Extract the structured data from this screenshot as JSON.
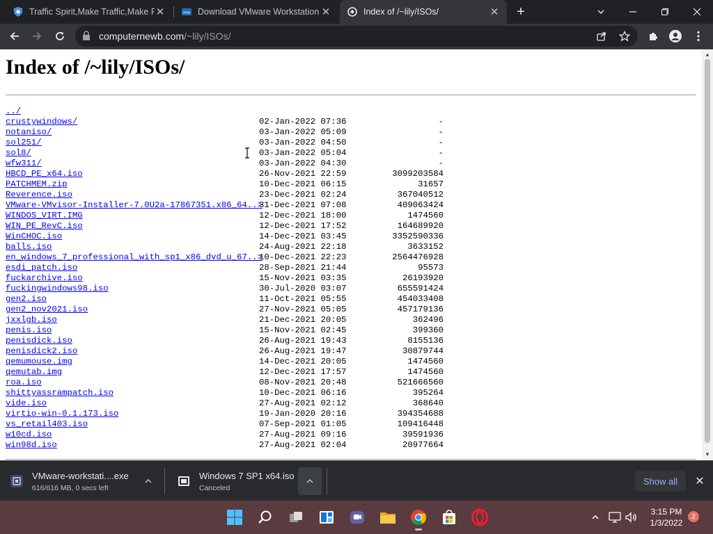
{
  "tabs": [
    {
      "title": "Traffic Spirit,Make Traffic,Make Free",
      "active": false
    },
    {
      "title": "Download VMware Workstation Pro",
      "active": false
    },
    {
      "title": "Index of /~lily/ISOs/",
      "active": true
    }
  ],
  "address": {
    "host": "computernewb.com",
    "path": "/~lily/ISOs/"
  },
  "page": {
    "heading": "Index of /~lily/ISOs/",
    "parent_link": "../",
    "rows": [
      {
        "name": "crustywindows/",
        "date": "02-Jan-2022 07:36",
        "size": "-"
      },
      {
        "name": "notaniso/",
        "date": "03-Jan-2022 05:09",
        "size": "-"
      },
      {
        "name": "sol251/",
        "date": "03-Jan-2022 04:50",
        "size": "-"
      },
      {
        "name": "sol8/",
        "date": "03-Jan-2022 05:04",
        "size": "-"
      },
      {
        "name": "wfw311/",
        "date": "03-Jan-2022 04:30",
        "size": "-"
      },
      {
        "name": "HBCD_PE_x64.iso",
        "date": "26-Nov-2021 22:59",
        "size": "3099203584"
      },
      {
        "name": "PATCHMEM.zip",
        "date": "10-Dec-2021 06:15",
        "size": "31657"
      },
      {
        "name": "Reverence.iso",
        "date": "23-Dec-2021 02:24",
        "size": "367040512"
      },
      {
        "name": "VMware-VMvisor-Installer-7.0U2a-17867351.x86_64..>",
        "date": "31-Dec-2021 07:08",
        "size": "409063424"
      },
      {
        "name": "WINDOS_VIRT.IMG",
        "date": "12-Dec-2021 18:00",
        "size": "1474560"
      },
      {
        "name": "WIN_PE_RevC.iso",
        "date": "12-Dec-2021 17:52",
        "size": "164689920"
      },
      {
        "name": "WinCHOC.iso",
        "date": "14-Dec-2021 03:45",
        "size": "3352590336"
      },
      {
        "name": "balls.iso",
        "date": "24-Aug-2021 22:18",
        "size": "3633152"
      },
      {
        "name": "en_windows_7_professional_with_sp1_x86_dvd_u_67..>",
        "date": "10-Dec-2021 22:23",
        "size": "2564476928"
      },
      {
        "name": "esdi_patch.iso",
        "date": "28-Sep-2021 21:44",
        "size": "95573"
      },
      {
        "name": "fuckarchive.iso",
        "date": "15-Nov-2021 03:35",
        "size": "26193920"
      },
      {
        "name": "fuckingwindows98.iso",
        "date": "30-Jul-2020 03:07",
        "size": "655591424"
      },
      {
        "name": "gen2.iso",
        "date": "11-Oct-2021 05:55",
        "size": "454033408"
      },
      {
        "name": "gen2_nov2021.iso",
        "date": "27-Nov-2021 05:05",
        "size": "457179136"
      },
      {
        "name": "jxxlgb.iso",
        "date": "21-Dec-2021 20:05",
        "size": "362496"
      },
      {
        "name": "penis.iso",
        "date": "15-Nov-2021 02:45",
        "size": "399360"
      },
      {
        "name": "penisdick.iso",
        "date": "26-Aug-2021 19:43",
        "size": "8155136"
      },
      {
        "name": "penisdick2.iso",
        "date": "26-Aug-2021 19:47",
        "size": "30879744"
      },
      {
        "name": "qemumouse.img",
        "date": "14-Dec-2021 20:05",
        "size": "1474560"
      },
      {
        "name": "qemutab.img",
        "date": "12-Dec-2021 17:57",
        "size": "1474560"
      },
      {
        "name": "roa.iso",
        "date": "08-Nov-2021 20:48",
        "size": "521666560"
      },
      {
        "name": "shittyassrampatch.iso",
        "date": "10-Dec-2021 06:16",
        "size": "395264"
      },
      {
        "name": "vide.iso",
        "date": "27-Aug-2021 02:12",
        "size": "368640"
      },
      {
        "name": "virtio-win-0.1.173.iso",
        "date": "19-Jan-2020 20:16",
        "size": "394354688"
      },
      {
        "name": "vs_retail403.iso",
        "date": "07-Sep-2021 01:05",
        "size": "109416448"
      },
      {
        "name": "w10cd.iso",
        "date": "27-Aug-2021 09:16",
        "size": "39591936"
      },
      {
        "name": "win98d.iso",
        "date": "27-Aug-2021 02:04",
        "size": "20977664"
      }
    ]
  },
  "downloads": [
    {
      "name": "VMware-workstati....exe",
      "status": "616/616 MB, 0 secs left"
    },
    {
      "name": "Windows 7 SP1 x64.iso",
      "status": "Canceled"
    }
  ],
  "shelf": {
    "show_all": "Show all"
  },
  "taskbar": {
    "time": "3:15 PM",
    "date": "1/3/2022",
    "notifications": "2"
  },
  "colors": {
    "link": "#0000ee",
    "accent": "#8ab4f8",
    "taskbar": "#5a3b3f"
  }
}
